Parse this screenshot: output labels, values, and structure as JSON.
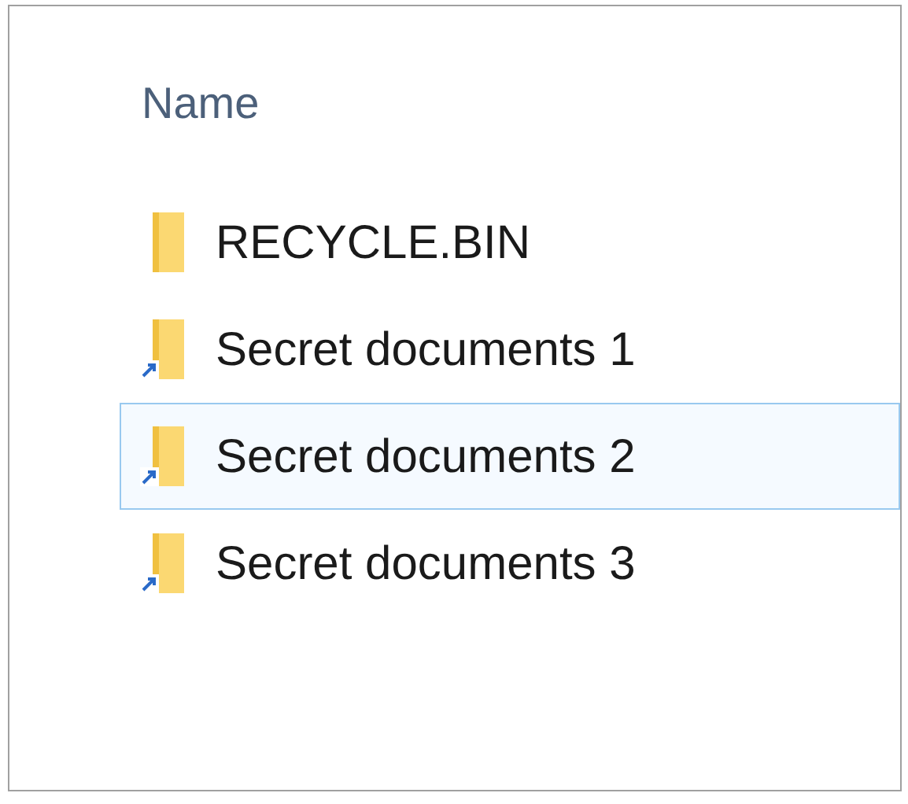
{
  "column_header": "Name",
  "items": [
    {
      "name": "RECYCLE.BIN",
      "kind": "folder",
      "selected": false
    },
    {
      "name": "Secret documents 1",
      "kind": "shortcut",
      "selected": false
    },
    {
      "name": "Secret documents 2",
      "kind": "shortcut",
      "selected": true
    },
    {
      "name": "Secret documents 3",
      "kind": "shortcut",
      "selected": false
    }
  ]
}
